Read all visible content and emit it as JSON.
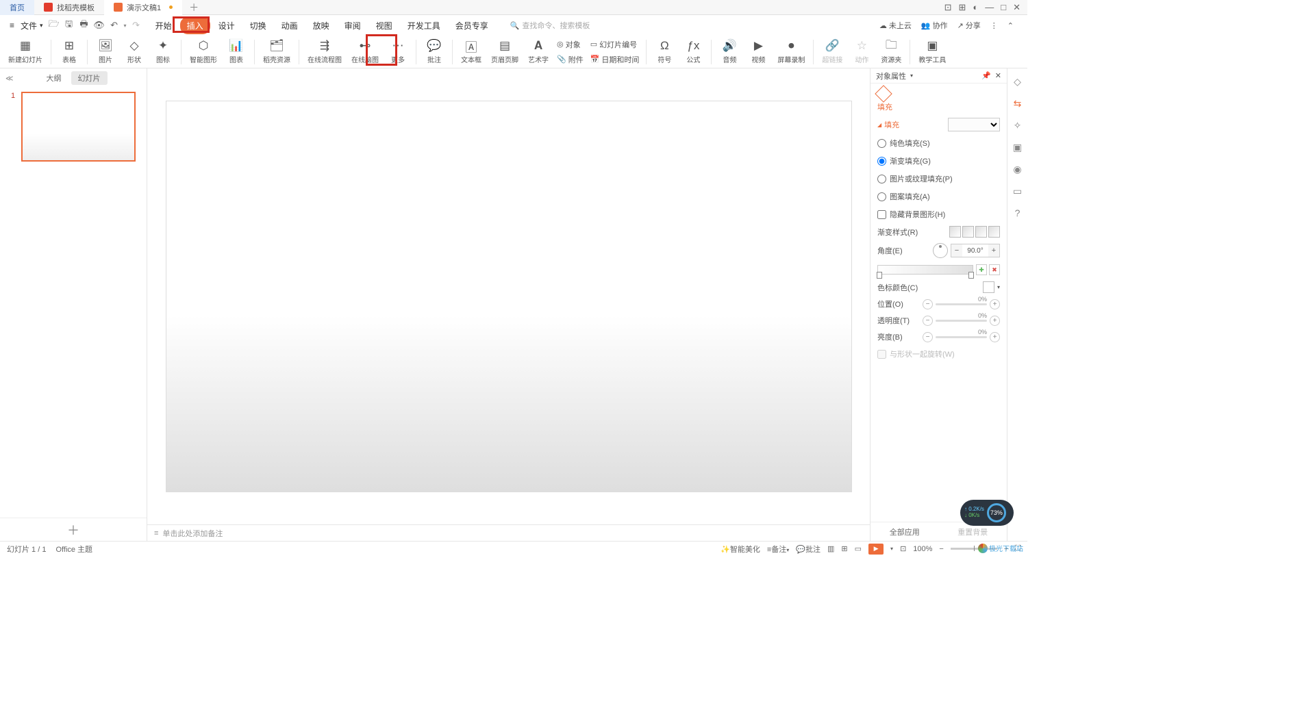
{
  "tabs": {
    "home": "首页",
    "t1": "找稻壳模板",
    "t2": "演示文稿1"
  },
  "file_menu": "文件",
  "menus": [
    "开始",
    "插入",
    "设计",
    "切换",
    "动画",
    "放映",
    "审阅",
    "视图",
    "开发工具",
    "会员专享"
  ],
  "active_menu_index": 1,
  "search_placeholder": "查找命令、搜索模板",
  "cloud": {
    "not_uploaded": "未上云",
    "coop": "协作",
    "share": "分享"
  },
  "ribbon": {
    "new_slide": "新建幻灯片",
    "table": "表格",
    "picture": "图片",
    "shape": "形状",
    "icon": "图标",
    "smart": "智能图形",
    "chart": "图表",
    "res": "稻壳资源",
    "flow": "在线流程图",
    "mind": "在线脑图",
    "more": "更多",
    "comment": "批注",
    "textbox": "文本框",
    "header": "页眉页脚",
    "wordart": "艺术字",
    "object": "对象",
    "slidenum": "幻灯片编号",
    "attach": "附件",
    "datetime": "日期和时间",
    "symbol": "符号",
    "formula": "公式",
    "audio": "音频",
    "video": "视频",
    "screenrec": "屏幕录制",
    "hyperlink": "超链接",
    "action": "动作",
    "resfolder": "资源夹",
    "teach": "教学工具"
  },
  "side": {
    "outline": "大纲",
    "slides": "幻灯片",
    "thumb_num": "1"
  },
  "notes_placeholder": "单击此处添加备注",
  "prop": {
    "title": "对象属性",
    "fill_tab": "填充",
    "section": "填充",
    "r_solid": "纯色填充(S)",
    "r_grad": "渐变填充(G)",
    "r_pic": "图片或纹理填充(P)",
    "r_pat": "图案填充(A)",
    "c_hidebg": "隐藏背景图形(H)",
    "grad_style": "渐变样式(R)",
    "angle": "角度(E)",
    "angle_val": "90.0°",
    "stop_color": "色标颜色(C)",
    "position": "位置(O)",
    "position_val": "0%",
    "transparency": "透明度(T)",
    "transparency_val": "0%",
    "brightness": "亮度(B)",
    "brightness_val": "0%",
    "rotate_with": "与形状一起旋转(W)",
    "apply_all": "全部应用",
    "reset_bg": "重置背景"
  },
  "status": {
    "slide_of": "幻灯片 1 / 1",
    "theme": "Office 主题",
    "beautify": "智能美化",
    "notes_toggle": "备注",
    "comment_toggle": "批注",
    "zoom": "100%"
  },
  "widget": {
    "pct": "73%",
    "up": "0.2K/s",
    "down": "0K/s"
  },
  "corner": "极光下载站"
}
